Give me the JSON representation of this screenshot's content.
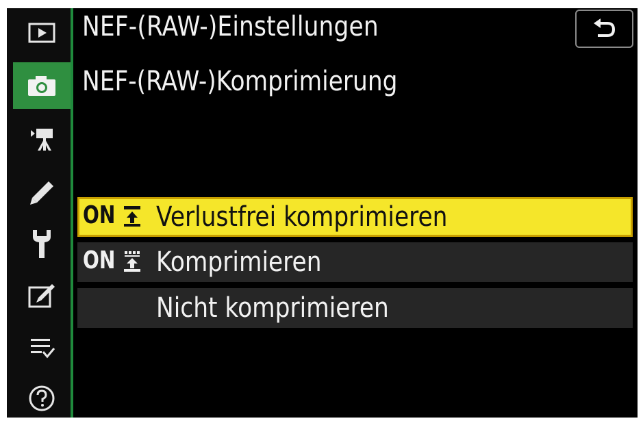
{
  "header": {
    "title": "NEF-(RAW-)Einstellungen",
    "subtitle": "NEF-(RAW-)Komprimierung"
  },
  "sidebar": {
    "items": [
      {
        "icon": "playback-icon",
        "active": false
      },
      {
        "icon": "camera-icon",
        "active": true
      },
      {
        "icon": "movie-icon",
        "active": false
      },
      {
        "icon": "pencil-icon",
        "active": false
      },
      {
        "icon": "wrench-icon",
        "active": false
      },
      {
        "icon": "retouch-icon",
        "active": false
      },
      {
        "icon": "my-menu-icon",
        "active": false
      },
      {
        "icon": "help-icon",
        "active": false
      }
    ]
  },
  "options": [
    {
      "prefix": "ON",
      "icon": "lossless-compressed-icon",
      "label": "Verlustfrei komprimieren",
      "selected": true
    },
    {
      "prefix": "ON",
      "icon": "compressed-icon",
      "label": "Komprimieren",
      "selected": false
    },
    {
      "prefix": "",
      "icon": "",
      "label": "Nicht komprimieren",
      "selected": false
    }
  ],
  "colors": {
    "accent": "#2f8f40",
    "selection": "#f5e62a",
    "selection_border": "#c9a000",
    "row": "#262626"
  }
}
